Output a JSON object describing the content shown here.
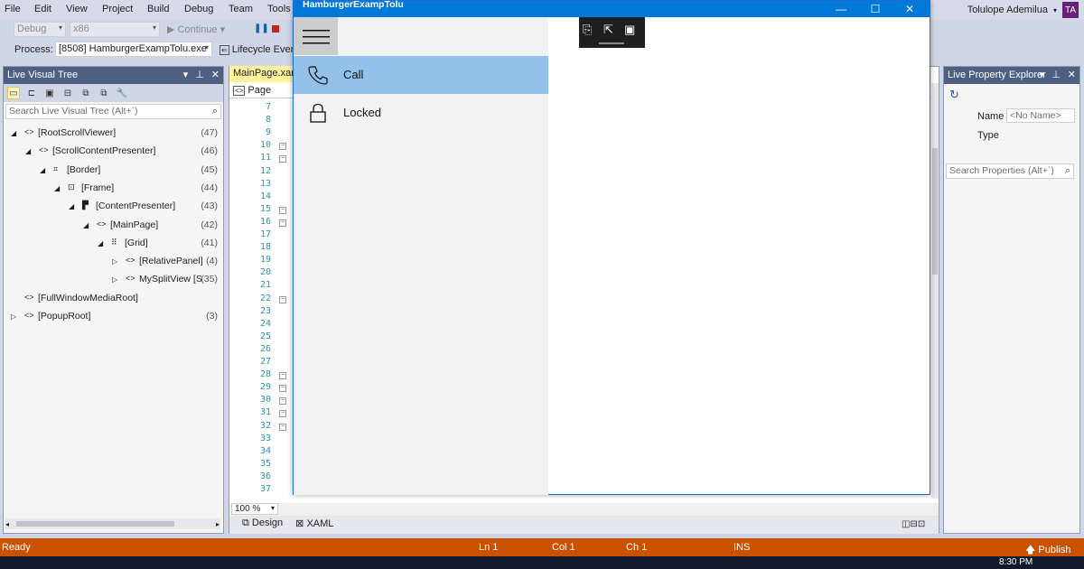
{
  "menu": {
    "items": [
      "File",
      "Edit",
      "View",
      "Project",
      "Build",
      "Debug",
      "Team",
      "Tools"
    ],
    "user_name": "Tolulope Ademilua",
    "user_initials": "TA"
  },
  "toolbar": {
    "config": "Debug",
    "platform": "x86",
    "continue_label": "Continue",
    "process_label": "Process:",
    "process_value": "[8508] HamburgerExampTolu.exe",
    "lifecycle_label": "Lifecycle Even"
  },
  "live_visual_tree": {
    "title": "Live Visual Tree",
    "search_placeholder": "Search Live Visual Tree (Alt+`)",
    "nodes": [
      {
        "expander": "◢",
        "label": "[RootScrollViewer]",
        "count": "(47)",
        "icon": "<>"
      },
      {
        "expander": "◢",
        "label": "[ScrollContentPresenter]",
        "count": "(46)",
        "icon": "<>"
      },
      {
        "expander": "◢",
        "label": "[Border]",
        "count": "(45)",
        "icon": "⌗"
      },
      {
        "expander": "◢",
        "label": "[Frame]",
        "count": "(44)",
        "icon": "⊡"
      },
      {
        "expander": "◢",
        "label": "[ContentPresenter]",
        "count": "(43)",
        "icon": "▛"
      },
      {
        "expander": "◢",
        "label": "[MainPage]",
        "count": "(42)",
        "icon": "<>"
      },
      {
        "expander": "◢",
        "label": "[Grid]",
        "count": "(41)",
        "icon": "⠿"
      },
      {
        "expander": "▷",
        "label": "[RelativePanel]",
        "count": "(4)",
        "icon": "<>"
      },
      {
        "expander": "▷",
        "label": "MySplitView [S",
        "count": "(35)",
        "icon": "<>"
      },
      {
        "expander": "",
        "label": "[FullWindowMediaRoot]",
        "count": "",
        "icon": "<>"
      },
      {
        "expander": "▷",
        "label": "[PopupRoot]",
        "count": "(3)",
        "icon": "<>"
      }
    ]
  },
  "editor": {
    "doc_tab": "MainPage.xam",
    "page_combo": "Page",
    "line_numbers": [
      "7",
      "8",
      "9",
      "10",
      "11",
      "12",
      "13",
      "14",
      "15",
      "16",
      "17",
      "18",
      "19",
      "20",
      "21",
      "22",
      "23",
      "24",
      "25",
      "26",
      "27",
      "28",
      "29",
      "30",
      "31",
      "32",
      "33",
      "34",
      "35",
      "36",
      "37"
    ],
    "zoom": "100 %",
    "design_tab": "Design",
    "xaml_tab": "XAML"
  },
  "live_property_explorer": {
    "title": "Live Property Explorer",
    "name_label": "Name",
    "name_value": "<No Name>",
    "type_label": "Type",
    "search_placeholder": "Search Properties (Alt+`)"
  },
  "app_window": {
    "title": "HamburgerExampTolu",
    "nav_items": [
      {
        "label": "Call",
        "icon": "phone-icon",
        "selected": true
      },
      {
        "label": "Locked",
        "icon": "lock-icon",
        "selected": false
      }
    ]
  },
  "status": {
    "ready": "Ready",
    "ln": "Ln 1",
    "col": "Col 1",
    "ch": "Ch 1",
    "ins": "INS",
    "publish": "Publish",
    "clock": "8:30 PM"
  },
  "colors": {
    "status_bar": "#ca5100",
    "app_titlebar": "#0078d7",
    "selected_nav": "#93c1ea",
    "panel_title": "#4d6082"
  }
}
